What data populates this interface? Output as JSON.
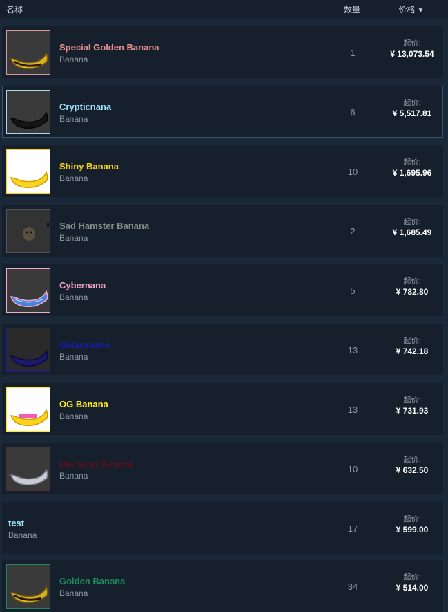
{
  "header": {
    "name_label": "名称",
    "quantity_label": "数量",
    "price_label": "价格",
    "sort_arrow": "▼"
  },
  "price_prefix": "起价:",
  "listings": [
    {
      "name": "Special Golden Banana",
      "type": "Banana",
      "quantity": "1",
      "price": "¥ 13,073.54",
      "name_color": "#e88f8f",
      "border_color": "#d99a9a",
      "thumb": "gold-banana-dark"
    },
    {
      "name": "Crypticnana",
      "type": "Banana",
      "quantity": "6",
      "price": "¥ 5,517.81",
      "name_color": "#9fe3ff",
      "border_color": "#a8d8ee",
      "thumb": "black-banana"
    },
    {
      "name": "Shiny Banana",
      "type": "Banana",
      "quantity": "10",
      "price": "¥ 1,695.96",
      "name_color": "#ffd21f",
      "border_color": "#ffd21f",
      "thumb": "yellow-banana"
    },
    {
      "name": "Sad Hamster Banana",
      "type": "Banana",
      "quantity": "2",
      "price": "¥ 1,685.49",
      "name_color": "#8a8a8a",
      "border_color": "#555555",
      "thumb": "hamster"
    },
    {
      "name": "Cybernana",
      "type": "Banana",
      "quantity": "5",
      "price": "¥ 782.80",
      "name_color": "#f29fc3",
      "border_color": "#f2a9c9",
      "thumb": "cyber-banana"
    },
    {
      "name": "Galaxynana",
      "type": "Banana",
      "quantity": "13",
      "price": "¥ 742.18",
      "name_color": "#1a1aaa",
      "border_color": "#1a1aaa",
      "thumb": "galaxy-banana"
    },
    {
      "name": "OG Banana",
      "type": "Banana",
      "quantity": "13",
      "price": "¥ 731.93",
      "name_color": "#ffe91f",
      "border_color": "#ffe91f",
      "thumb": "og-banana"
    },
    {
      "name": "Diamond Banana",
      "type": "Banana",
      "quantity": "10",
      "price": "¥ 632.50",
      "name_color": "#5a0f1c",
      "border_color": "#5a2a32",
      "thumb": "diamond-banana"
    },
    {
      "name": "test",
      "type": "Banana",
      "quantity": "17",
      "price": "¥ 599.00",
      "name_color": "#9fe3ff",
      "border_color": "",
      "thumb": ""
    },
    {
      "name": "Golden Banana",
      "type": "Banana",
      "quantity": "34",
      "price": "¥ 514.00",
      "name_color": "#1c8a5a",
      "border_color": "#1c8a5a",
      "thumb": "gold-banana-dark"
    }
  ]
}
